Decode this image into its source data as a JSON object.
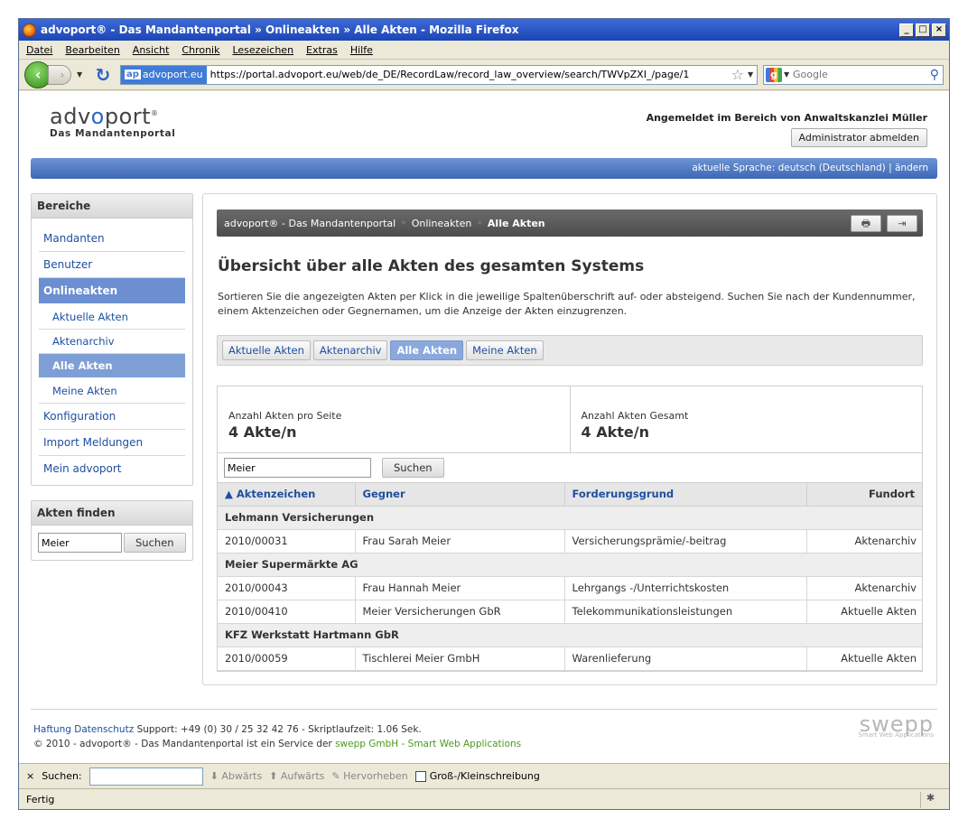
{
  "window": {
    "title": "advoport® - Das Mandantenportal » Onlineakten » Alle Akten - Mozilla Firefox",
    "min": "_",
    "max": "□",
    "close": "×"
  },
  "menu": [
    "Datei",
    "Bearbeiten",
    "Ansicht",
    "Chronik",
    "Lesezeichen",
    "Extras",
    "Hilfe"
  ],
  "nav": {
    "back_icon": "back-arrow-icon",
    "site_id_badge": "ap",
    "site_id": "advoport.eu",
    "url": "https://portal.advoport.eu/web/de_DE/RecordLaw/record_law_overview/search/TWVpZXI_/page/1",
    "search_placeholder": "Google"
  },
  "header": {
    "brand_pre": "adv",
    "brand_o": "o",
    "brand_post": "port",
    "brand_mark": "®",
    "subtitle": "Das Mandantenportal",
    "login_text": "Angemeldet im Bereich von Anwaltskanzlei Müller",
    "logout_label": "Administrator abmelden",
    "language_text": "aktuelle Sprache: deutsch (Deutschland) | ändern"
  },
  "sidebar": {
    "areas_title": "Bereiche",
    "items": [
      {
        "label": "Mandanten",
        "level": 0,
        "active": false
      },
      {
        "label": "Benutzer",
        "level": 0,
        "active": false
      },
      {
        "label": "Onlineakten",
        "level": 0,
        "active": true
      },
      {
        "label": "Aktuelle Akten",
        "level": 1,
        "active": false
      },
      {
        "label": "Aktenarchiv",
        "level": 1,
        "active": false
      },
      {
        "label": "Alle Akten",
        "level": 1,
        "active": true
      },
      {
        "label": "Meine Akten",
        "level": 1,
        "active": false
      },
      {
        "label": "Konfiguration",
        "level": 0,
        "active": false
      },
      {
        "label": "Import Meldungen",
        "level": 0,
        "active": false
      },
      {
        "label": "Mein advoport",
        "level": 0,
        "active": false
      }
    ],
    "finder_title": "Akten finden",
    "finder_value": "Meier",
    "finder_button": "Suchen"
  },
  "breadcrumb": [
    "advoport® - Das Mandantenportal",
    "Onlineakten",
    "Alle Akten"
  ],
  "breadcrumb_sep": "»",
  "tools": {
    "print": "🖶",
    "export": "⇥"
  },
  "main": {
    "title": "Übersicht über alle Akten des gesamten Systems",
    "intro": "Sortieren Sie die angezeigten Akten per Klick in die jeweilige Spaltenüberschrift auf- oder absteigend. Suchen Sie nach der Kundennummer, einem Aktenzeichen oder Gegnernamen, um die Anzeige der Akten einzugrenzen.",
    "tabs": [
      {
        "label": "Aktuelle Akten",
        "active": false
      },
      {
        "label": "Aktenarchiv",
        "active": false
      },
      {
        "label": "Alle Akten",
        "active": true
      },
      {
        "label": "Meine Akten",
        "active": false
      }
    ],
    "stats": {
      "per_page_label": "Anzahl Akten pro Seite",
      "per_page_value": "4 Akte/n",
      "total_label": "Anzahl Akten Gesamt",
      "total_value": "4 Akte/n"
    },
    "search_value": "Meier",
    "search_button": "Suchen",
    "columns": [
      "▲ Aktenzeichen",
      "Gegner",
      "Forderungsgrund",
      "Fundort"
    ],
    "groups": [
      {
        "name": "Lehmann Versicherungen",
        "rows": [
          [
            "2010/00031",
            "Frau Sarah Meier",
            "Versicherungsprämie/-beitrag",
            "Aktenarchiv"
          ]
        ]
      },
      {
        "name": "Meier Supermärkte AG",
        "rows": [
          [
            "2010/00043",
            "Frau Hannah Meier",
            "Lehrgangs -/Unterrichtskosten",
            "Aktenarchiv"
          ],
          [
            "2010/00410",
            "Meier Versicherungen GbR",
            "Telekommunikationsleistungen",
            "Aktuelle Akten"
          ]
        ]
      },
      {
        "name": "KFZ Werkstatt Hartmann GbR",
        "rows": [
          [
            "2010/00059",
            "Tischlerei Meier GmbH",
            "Warenlieferung",
            "Aktuelle Akten"
          ]
        ]
      }
    ]
  },
  "footer": {
    "haftung": "Haftung",
    "datenschutz": "Datenschutz",
    "support": "Support: +49 (0) 30 / 25 32 42 76 - Skriptlaufzeit: 1.06 Sek.",
    "copyright": "© 2010 - advoport® - Das Mandantenportal ist ein Service der",
    "swepp_link": "swepp GmbH - Smart Web Applications",
    "swepp_logo": "swepp",
    "swepp_sub": "Smart Web Applications"
  },
  "findbar": {
    "close": "×",
    "label": "Suchen:",
    "down": "Abwärts",
    "up": "Aufwärts",
    "highlight": "Hervorheben",
    "case": "Groß-/Kleinschreibung"
  },
  "status": {
    "text": "Fertig"
  }
}
